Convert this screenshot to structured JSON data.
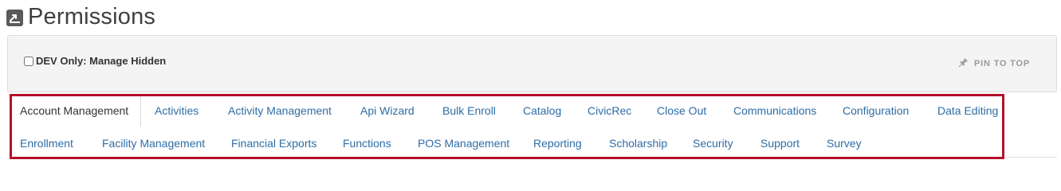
{
  "header": {
    "title": "Permissions",
    "icon": "permissions-app-icon"
  },
  "panel": {
    "dev_only_label": "DEV Only: Manage Hidden",
    "dev_only_checked": false,
    "pin_label": "PIN TO TOP",
    "pin_icon": "pin-icon"
  },
  "tabs": {
    "active": "Account Management",
    "items": [
      "Account Management",
      "Activities",
      "Activity Management",
      "Api Wizard",
      "Bulk Enroll",
      "Catalog",
      "CivicRec",
      "Close Out",
      "Communications",
      "Configuration",
      "Data Editing",
      "Enrollment",
      "Facility Management",
      "Financial Exports",
      "Functions",
      "POS Management",
      "Reporting",
      "Scholarship",
      "Security",
      "Support",
      "Survey"
    ]
  },
  "colors": {
    "link": "#2e6da4",
    "highlight_outline": "#b5102a",
    "panel_bg": "#f4f4f4"
  }
}
